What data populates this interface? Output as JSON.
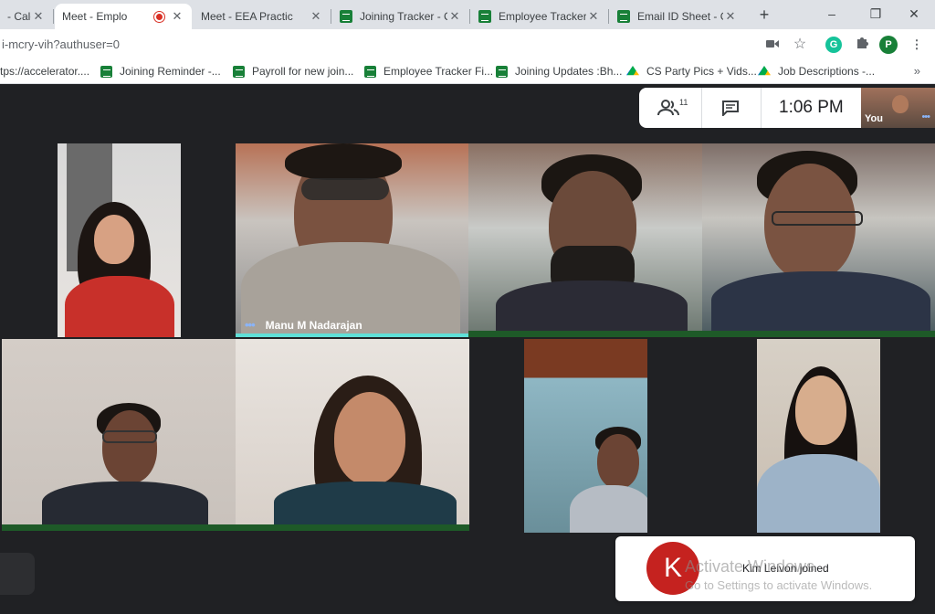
{
  "tabs": [
    {
      "label": "- Cale",
      "icon": "calendar-icon"
    },
    {
      "label": "Meet - Emplo",
      "icon": "meet-icon",
      "recording": true
    },
    {
      "label": "Meet - EEA Practic",
      "icon": "meet-icon"
    },
    {
      "label": "Joining Tracker - C",
      "icon": "sheets-icon"
    },
    {
      "label": "Employee Tracker",
      "icon": "sheets-icon"
    },
    {
      "label": "Email ID Sheet - G",
      "icon": "sheets-icon"
    }
  ],
  "window": {
    "new_tab": "+",
    "minimize": "–",
    "restore": "❐",
    "close": "✕"
  },
  "address": {
    "url": "i-mcry-vih?authuser=0",
    "profile_initial": "P",
    "grammarly": "G"
  },
  "bookmarks": [
    {
      "label": "tps://accelerator....",
      "icon": "none"
    },
    {
      "label": "Joining Reminder -...",
      "icon": "sheets-icon"
    },
    {
      "label": "Payroll for new join...",
      "icon": "sheets-icon"
    },
    {
      "label": "Employee Tracker Fi...",
      "icon": "sheets-icon"
    },
    {
      "label": "Joining Updates :Bh...",
      "icon": "sheets-icon"
    },
    {
      "label": "CS Party Pics + Vids...",
      "icon": "drive-icon"
    },
    {
      "label": "Job Descriptions -...",
      "icon": "drive-icon"
    }
  ],
  "bookmarks_more": "»",
  "meet": {
    "participants_count": "11",
    "time": "1:06 PM",
    "self_label": "You",
    "tiles": [
      {
        "name": ""
      },
      {
        "name": "Manu M Nadarajan",
        "speaking": true
      },
      {
        "name": ""
      },
      {
        "name": ""
      },
      {
        "name": ""
      },
      {
        "name": ""
      },
      {
        "name": ""
      },
      {
        "name": ""
      }
    ]
  },
  "toast": {
    "avatar_initial": "K",
    "message": "Kim Leivon joined"
  },
  "watermark": {
    "line1": "Activate Windows",
    "line2": "Go to Settings to activate Windows."
  },
  "colors": {
    "meet_bg": "#202124",
    "speaking": "#5fe0d8",
    "active_bar": "#1e5a28",
    "toast_avatar": "#c5221f"
  }
}
